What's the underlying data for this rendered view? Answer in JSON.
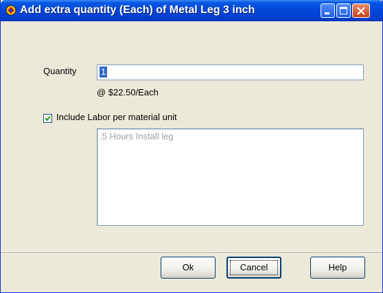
{
  "window": {
    "title": "Add extra quantity (Each) of Metal Leg  3 inch",
    "app_icon": "app-logo-icon",
    "controls": [
      "minimize-icon",
      "maximize-icon",
      "close-icon"
    ]
  },
  "form": {
    "quantity_label": "Quantity",
    "quantity_value": "1",
    "price_text": "@ $22.50/Each",
    "include_labor_label": "Include Labor per material unit",
    "include_labor_checked": true,
    "labor_text": ".5 Hours Install leg"
  },
  "buttons": {
    "ok": "Ok",
    "cancel": "Cancel",
    "help": "Help"
  }
}
